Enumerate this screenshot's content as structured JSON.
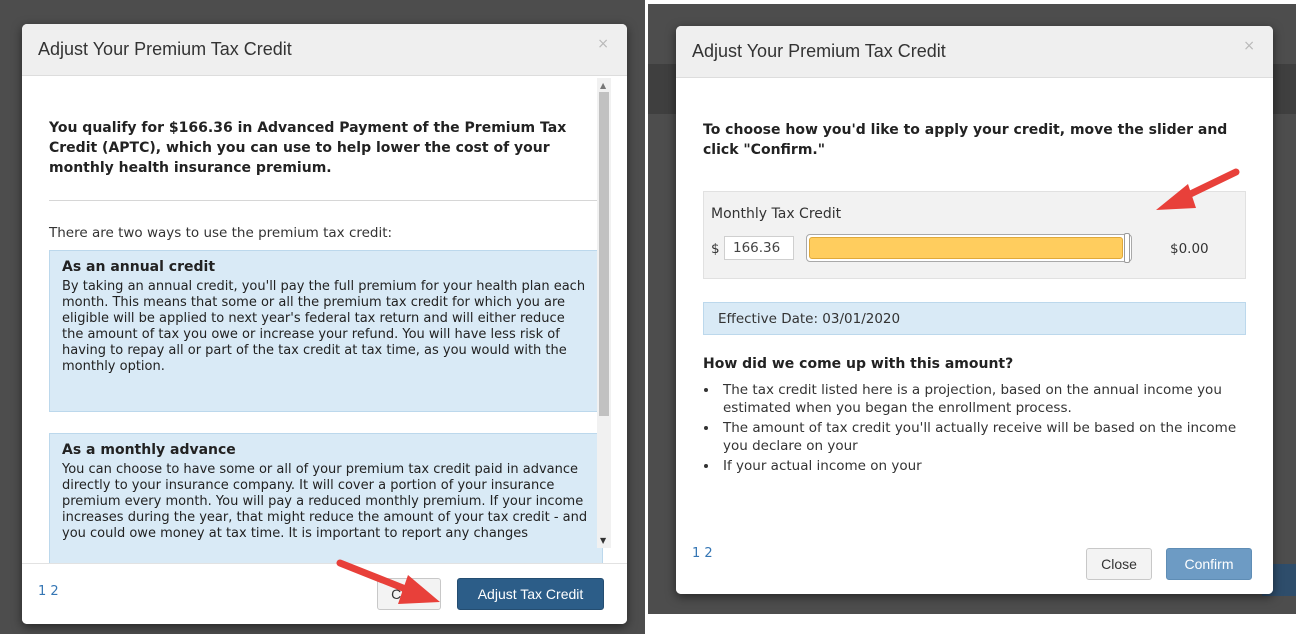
{
  "left_modal": {
    "title": "Adjust Your Premium Tax Credit",
    "close_icon": "×",
    "lead": "You qualify for $166.36 in Advanced Payment of the Premium Tax Credit (APTC), which you can use to help lower the cost of your monthly health insurance premium.",
    "intro": "There are two ways to use the premium tax credit:",
    "annual": {
      "heading": "As an annual credit",
      "text": "By taking an annual credit, you'll pay the full premium for your health plan each month. This means that some or all the premium tax credit for which you are eligible will be applied to next year's federal tax return and will either reduce the amount of tax you owe or increase your refund. You will have less risk of having to repay all or part of the tax credit at tax time, as you would with the monthly option."
    },
    "monthly": {
      "heading": "As a monthly advance",
      "text": "You can choose to have some or all of your premium tax credit paid in advance directly to your insurance company. It will cover a portion of your insurance premium every month. You will pay a reduced monthly premium. If your income increases during the year, that might reduce the amount of your tax credit - and you could owe money at tax time. It is important to report any changes"
    },
    "pager": "1 2",
    "close_button": "Close",
    "adjust_button": "Adjust Tax Credit"
  },
  "right_modal": {
    "title": "Adjust Your Premium Tax Credit",
    "close_icon": "×",
    "lead": "To choose how you'd like to apply your credit, move the slider and click \"Confirm.\"",
    "slider_label": "Monthly Tax Credit",
    "currency": "$",
    "credit_value": "166.36",
    "slider_fraction": 1.0,
    "slider_max_label": "$0.00",
    "effective_date": "Effective Date: 03/01/2020",
    "how_heading": "How did we come up with this amount?",
    "bullets": [
      "The tax credit listed here is a projection, based on the annual income you estimated when you began the enrollment process.",
      "The amount of tax credit you'll actually receive will be based on the income you declare on your",
      "If your actual income on your"
    ],
    "pager": "1 2",
    "close_button": "Close",
    "confirm_button": "Confirm"
  },
  "colors": {
    "slider_fill": "#ffcd5e",
    "arrow": "#e8403a",
    "primary_button": "#2c5d88",
    "info_box": "#d9eaf6"
  }
}
